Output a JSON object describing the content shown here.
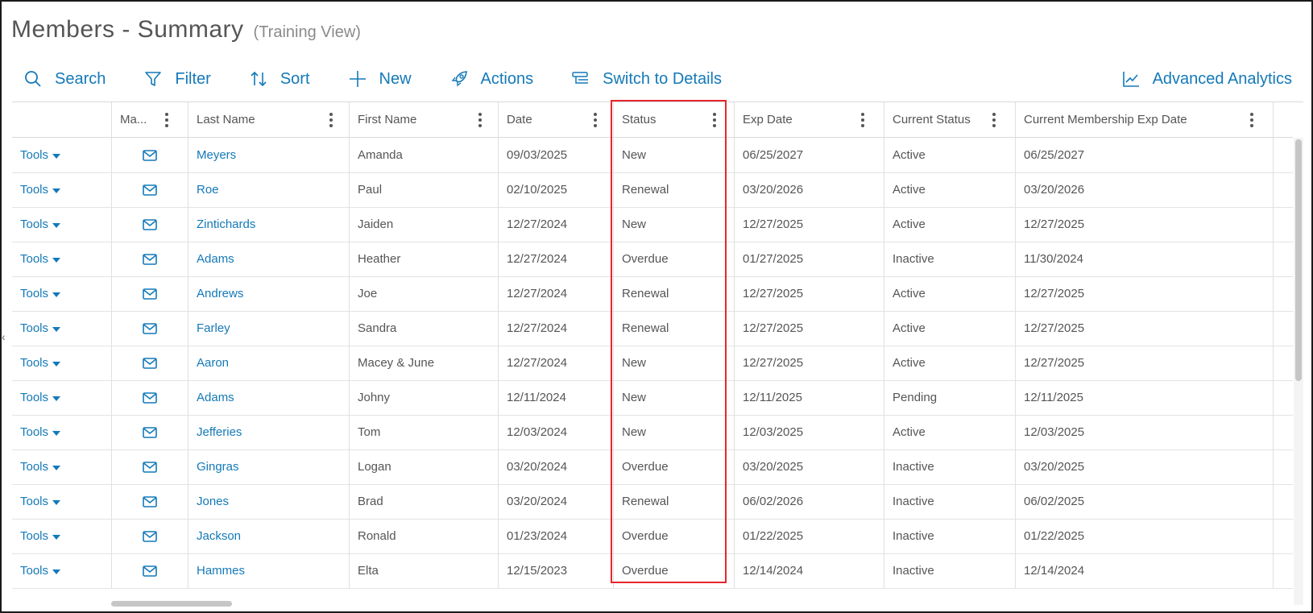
{
  "page": {
    "title": "Members - Summary",
    "subtitle": "(Training View)"
  },
  "toolbar": {
    "search": "Search",
    "filter": "Filter",
    "sort": "Sort",
    "new": "New",
    "actions": "Actions",
    "switch": "Switch to Details",
    "analytics": "Advanced Analytics"
  },
  "columns": [
    "",
    "Ma...",
    "Last Name",
    "First Name",
    "Date",
    "Status",
    "Exp Date",
    "Current Status",
    "Current Membership Exp Date"
  ],
  "tools_label": "Tools",
  "rows": [
    {
      "last": "Meyers",
      "first": "Amanda",
      "date": "09/03/2025",
      "status": "New",
      "exp": "06/25/2027",
      "current": "Active",
      "cur_exp": "06/25/2027"
    },
    {
      "last": "Roe",
      "first": "Paul",
      "date": "02/10/2025",
      "status": "Renewal",
      "exp": "03/20/2026",
      "current": "Active",
      "cur_exp": "03/20/2026"
    },
    {
      "last": "Zintichards",
      "first": "Jaiden",
      "date": "12/27/2024",
      "status": "New",
      "exp": "12/27/2025",
      "current": "Active",
      "cur_exp": "12/27/2025"
    },
    {
      "last": "Adams",
      "first": "Heather",
      "date": "12/27/2024",
      "status": "Overdue",
      "exp": "01/27/2025",
      "current": "Inactive",
      "cur_exp": "11/30/2024"
    },
    {
      "last": "Andrews",
      "first": "Joe",
      "date": "12/27/2024",
      "status": "Renewal",
      "exp": "12/27/2025",
      "current": "Active",
      "cur_exp": "12/27/2025"
    },
    {
      "last": "Farley",
      "first": "Sandra",
      "date": "12/27/2024",
      "status": "Renewal",
      "exp": "12/27/2025",
      "current": "Active",
      "cur_exp": "12/27/2025"
    },
    {
      "last": "Aaron",
      "first": "Macey & June",
      "date": "12/27/2024",
      "status": "New",
      "exp": "12/27/2025",
      "current": "Active",
      "cur_exp": "12/27/2025"
    },
    {
      "last": "Adams",
      "first": "Johny",
      "date": "12/11/2024",
      "status": "New",
      "exp": "12/11/2025",
      "current": "Pending",
      "cur_exp": "12/11/2025"
    },
    {
      "last": "Jefferies",
      "first": "Tom",
      "date": "12/03/2024",
      "status": "New",
      "exp": "12/03/2025",
      "current": "Active",
      "cur_exp": "12/03/2025"
    },
    {
      "last": "Gingras",
      "first": "Logan",
      "date": "03/20/2024",
      "status": "Overdue",
      "exp": "03/20/2025",
      "current": "Inactive",
      "cur_exp": "03/20/2025"
    },
    {
      "last": "Jones",
      "first": "Brad",
      "date": "03/20/2024",
      "status": "Renewal",
      "exp": "06/02/2026",
      "current": "Inactive",
      "cur_exp": "06/02/2025"
    },
    {
      "last": "Jackson",
      "first": "Ronald",
      "date": "01/23/2024",
      "status": "Overdue",
      "exp": "01/22/2025",
      "current": "Inactive",
      "cur_exp": "01/22/2025"
    },
    {
      "last": "Hammes",
      "first": "Elta",
      "date": "12/15/2023",
      "status": "Overdue",
      "exp": "12/14/2024",
      "current": "Inactive",
      "cur_exp": "12/14/2024"
    }
  ],
  "colors": {
    "accent": "#1479b8",
    "highlight": "#e8262c"
  }
}
